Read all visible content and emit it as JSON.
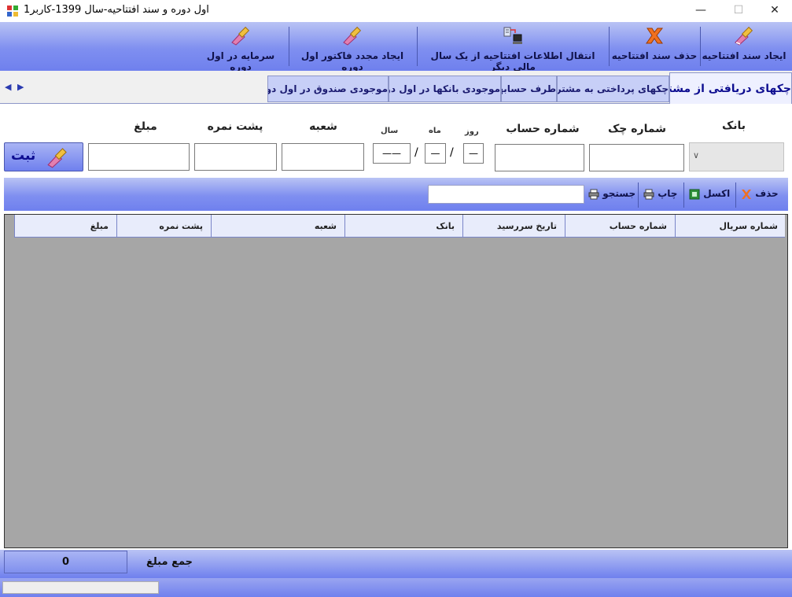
{
  "window": {
    "title": "اول دوره و سند افتتاحیه-سال 1399-کاربر1",
    "minimize": "—",
    "maximize": "☐",
    "close": "✕"
  },
  "toolbar": {
    "create_opening": "ایجاد سند افتتاحیه",
    "delete_opening": "حذف سند افتتاحیه",
    "transfer_opening": "انتقال اطلاعات افتتاحیه از یک سال مالی دیگر",
    "recreate_invoice": "ایجاد مجدد فاکتور اول دوره",
    "opening_capital": "سرمایه در اول دوره"
  },
  "tabs": [
    "چکهای دریافتی از مشتریان",
    "چکهای پرداختی به مشتریان",
    "طرف حسابها",
    "موجودی بانکها در اول دوره",
    "موجودی صندوق در اول دوره"
  ],
  "tab_scroll": "◀ ▶",
  "form": {
    "bank_label": "بانک",
    "check_number_label": "شماره چک",
    "account_number_label": "شماره حساب",
    "day_label": "روز",
    "month_label": "ماه",
    "year_label": "سال",
    "branch_label": "شعبه",
    "back_number_label": "پشت نمره",
    "amount_label": "مبلغ",
    "day_value": "—",
    "month_value": "—",
    "year_value": "——",
    "slash": "/",
    "submit": "ثبت"
  },
  "gridbar": {
    "delete": "حذف",
    "excel": "اکسل",
    "print": "چاپ",
    "search": "جستجو",
    "search_value": ""
  },
  "grid": {
    "columns": [
      "شماره سریال",
      "شماره حساب",
      "تاریخ سررسید",
      "بانک",
      "شعبه",
      "پشت نمره",
      "مبلغ"
    ],
    "rows": []
  },
  "footer": {
    "total_label": "جمع مبلغ",
    "total_value": "0"
  },
  "colors": {
    "accent": "#6f80ee",
    "header_light": "#b9c3f4",
    "tab": "#c7cff7",
    "grid_bg": "#a6a6a6"
  }
}
